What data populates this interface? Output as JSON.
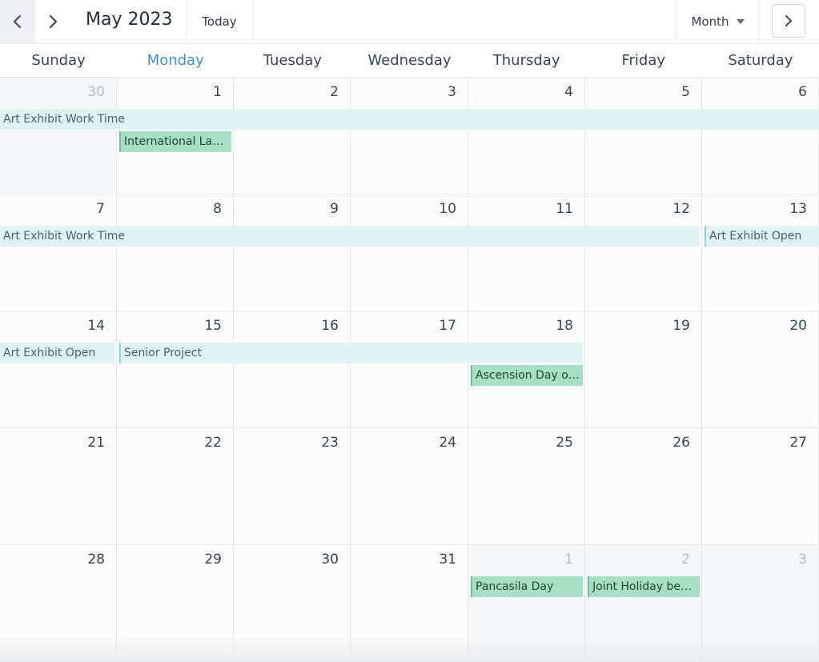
{
  "header": {
    "title": "May 2023",
    "today_label": "Today",
    "view_label": "Month",
    "icons": {
      "prev": "chevron-left-icon",
      "next": "chevron-right-icon",
      "dropdown": "caret-down-icon",
      "forward": "chevron-right-icon"
    }
  },
  "weekdays": [
    "Sunday",
    "Monday",
    "Tuesday",
    "Wednesday",
    "Thursday",
    "Friday",
    "Saturday"
  ],
  "today_weekday": "Monday",
  "weeks": [
    {
      "days": [
        {
          "day": "30",
          "current": false
        },
        {
          "day": "1",
          "current": true
        },
        {
          "day": "2",
          "current": true
        },
        {
          "day": "3",
          "current": true
        },
        {
          "day": "4",
          "current": true
        },
        {
          "day": "5",
          "current": true
        },
        {
          "day": "6",
          "current": true
        }
      ],
      "events": [
        {
          "title": "Art Exhibit Work Time",
          "start": 0,
          "span": 7,
          "row": 0,
          "kind": "multi-day"
        },
        {
          "title": "International La…",
          "start": 1,
          "span": 1,
          "row": 1,
          "kind": "holiday"
        }
      ]
    },
    {
      "days": [
        {
          "day": "7",
          "current": true
        },
        {
          "day": "8",
          "current": true
        },
        {
          "day": "9",
          "current": true
        },
        {
          "day": "10",
          "current": true
        },
        {
          "day": "11",
          "current": true
        },
        {
          "day": "12",
          "current": true
        },
        {
          "day": "13",
          "current": true
        }
      ],
      "events": [
        {
          "title": "Art Exhibit Work Time",
          "start": 0,
          "span": 6,
          "row": 0,
          "kind": "multi-day"
        },
        {
          "title": "Art Exhibit Open",
          "start": 6,
          "span": 1,
          "row": 0,
          "kind": "multi-day-start"
        }
      ]
    },
    {
      "days": [
        {
          "day": "14",
          "current": true
        },
        {
          "day": "15",
          "current": true
        },
        {
          "day": "16",
          "current": true
        },
        {
          "day": "17",
          "current": true
        },
        {
          "day": "18",
          "current": true
        },
        {
          "day": "19",
          "current": true
        },
        {
          "day": "20",
          "current": true
        }
      ],
      "events": [
        {
          "title": "Art Exhibit Open",
          "start": 0,
          "span": 1,
          "row": 0,
          "kind": "multi-day"
        },
        {
          "title": "Senior Project",
          "start": 1,
          "span": 4,
          "row": 0,
          "kind": "multi-day-start"
        },
        {
          "title": "Ascension Day o…",
          "start": 4,
          "span": 1,
          "row": 1,
          "kind": "holiday"
        }
      ]
    },
    {
      "days": [
        {
          "day": "21",
          "current": true
        },
        {
          "day": "22",
          "current": true
        },
        {
          "day": "23",
          "current": true
        },
        {
          "day": "24",
          "current": true
        },
        {
          "day": "25",
          "current": true
        },
        {
          "day": "26",
          "current": true
        },
        {
          "day": "27",
          "current": true
        }
      ],
      "events": []
    },
    {
      "days": [
        {
          "day": "28",
          "current": true
        },
        {
          "day": "29",
          "current": true
        },
        {
          "day": "30",
          "current": true
        },
        {
          "day": "31",
          "current": true
        },
        {
          "day": "1",
          "current": false
        },
        {
          "day": "2",
          "current": false
        },
        {
          "day": "3",
          "current": false
        }
      ],
      "events": [
        {
          "title": "Pancasila Day",
          "start": 4,
          "span": 1,
          "row": 0,
          "kind": "holiday"
        },
        {
          "title": "Joint Holiday be…",
          "start": 5,
          "span": 1,
          "row": 0,
          "kind": "holiday"
        }
      ]
    }
  ],
  "colors": {
    "accent": "#3a8fd6",
    "multi_day_event": "#dff3f5",
    "holiday_event": "#a6dfc4"
  }
}
